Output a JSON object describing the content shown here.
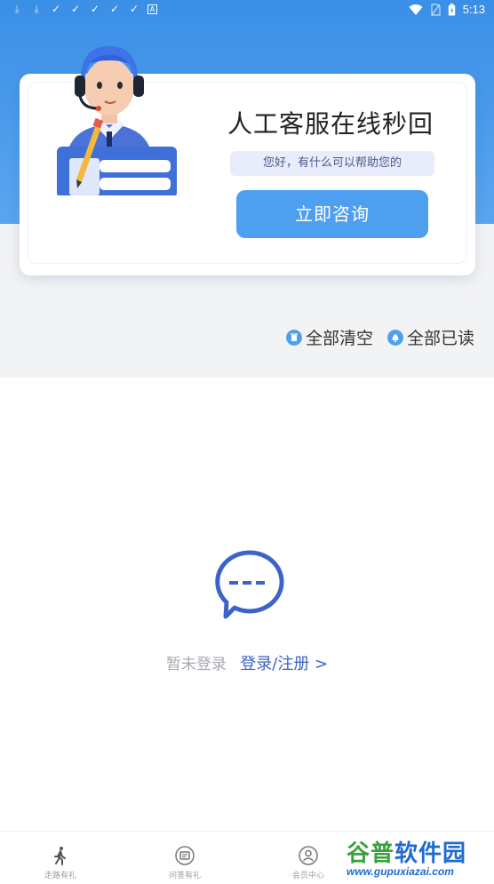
{
  "status_bar": {
    "time": "5:13",
    "left_icons": [
      "download-icon",
      "download-icon",
      "check-icon",
      "check-icon",
      "check-icon",
      "check-icon",
      "check-icon",
      "a-icon"
    ],
    "right_icons": [
      "wifi-icon",
      "sim-icon",
      "battery-icon"
    ]
  },
  "service_card": {
    "title": "人工客服在线秒回",
    "subtitle": "您好，有什么可以帮助您的",
    "consult_button": "立即咨询"
  },
  "actions": {
    "clear_all": "全部清空",
    "mark_all_read": "全部已读"
  },
  "empty_state": {
    "not_logged_in": "暂未登录",
    "login_link": "登录/注册 >"
  },
  "tab_bar": {
    "tabs": [
      {
        "label": "走路有礼",
        "icon": "walking-icon"
      },
      {
        "label": "问答有礼",
        "icon": "quiz-icon"
      },
      {
        "label": "会员中心",
        "icon": "member-icon"
      }
    ]
  },
  "watermark": {
    "logo_green": "谷普",
    "logo_blue": "软件园",
    "url": "www.gupuxiazai.com"
  },
  "colors": {
    "header_blue": "#3a8fe6",
    "button_blue": "#4f9ff0",
    "link_blue": "#3d63c9"
  }
}
